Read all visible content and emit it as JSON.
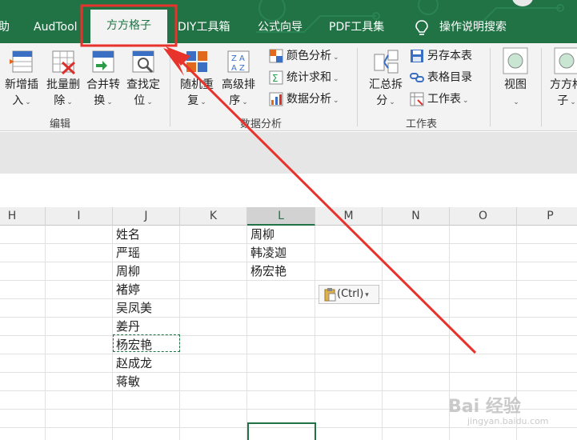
{
  "tabs": {
    "items": [
      "助",
      "AudTool",
      "方方格子",
      "DIY工具箱",
      "公式向导",
      "PDF工具集",
      "操作说明搜索"
    ],
    "active": "方方格子"
  },
  "ribbon": {
    "edit_group": {
      "label": "编辑",
      "buttons": [
        {
          "line1": "新增插",
          "line2": "入"
        },
        {
          "line1": "批量删",
          "line2": "除"
        },
        {
          "line1": "合并转",
          "line2": "换"
        },
        {
          "line1": "查找定",
          "line2": "位"
        }
      ]
    },
    "data_group": {
      "label": "数据分析",
      "buttons": [
        {
          "line1": "随机重",
          "line2": "复"
        },
        {
          "line1": "高级排",
          "line2": "序"
        }
      ],
      "small": [
        "颜色分析",
        "统计求和",
        "数据分析"
      ]
    },
    "sheet_group": {
      "label": "工作表",
      "buttons": [
        {
          "line1": "汇总拆",
          "line2": "分"
        }
      ],
      "small": [
        "另存本表",
        "表格目录",
        "工作表"
      ]
    },
    "view_button": {
      "line1": "视图"
    },
    "fangfang_button": {
      "line1": "方方格",
      "line2": "子"
    }
  },
  "sheet": {
    "columns": [
      "H",
      "I",
      "J",
      "K",
      "L",
      "M",
      "N",
      "O",
      "P"
    ],
    "selected_column": "L",
    "col_j": [
      "姓名",
      "严瑶",
      "周柳",
      "褚婷",
      "吴凤美",
      "姜丹",
      "杨宏艳",
      "赵成龙",
      "蒋敏"
    ],
    "col_l": [
      "周柳",
      "韩凌迦",
      "杨宏艳"
    ],
    "paste_options": "(Ctrl)"
  },
  "watermark": {
    "text": "Bai 经验",
    "sub": "jingyan.baidu.com"
  },
  "colors": {
    "accent": "#217346",
    "annotation": "#e8322c"
  }
}
